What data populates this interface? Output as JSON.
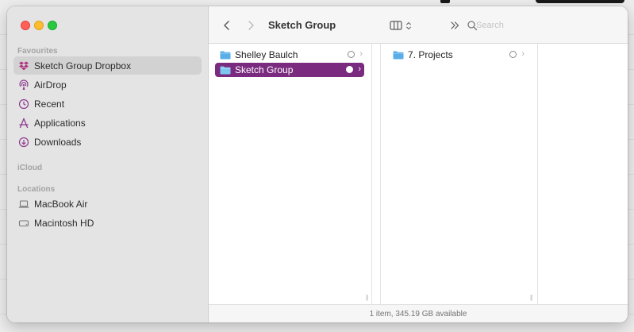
{
  "window": {
    "title": "Sketch Group"
  },
  "sidebar": {
    "sections": {
      "favourites": "Favourites",
      "icloud": "iCloud",
      "locations": "Locations"
    },
    "favourites": [
      {
        "label": "Sketch Group Dropbox",
        "icon": "dropbox-icon",
        "selected": true
      },
      {
        "label": "AirDrop",
        "icon": "airdrop-icon"
      },
      {
        "label": "Recent",
        "icon": "clock-icon"
      },
      {
        "label": "Applications",
        "icon": "applications-icon"
      },
      {
        "label": "Downloads",
        "icon": "download-icon"
      }
    ],
    "locations": [
      {
        "label": "MacBook Air",
        "icon": "laptop-icon"
      },
      {
        "label": "Macintosh HD",
        "icon": "disk-icon"
      }
    ]
  },
  "toolbar": {
    "title": "Sketch Group",
    "search_placeholder": "Search"
  },
  "columns": [
    {
      "items": [
        {
          "label": "Shelley Baulch",
          "icon": "folder-icon",
          "selected": false
        },
        {
          "label": "Sketch Group",
          "icon": "folder-icon",
          "selected": true
        }
      ]
    },
    {
      "items": [
        {
          "label": "7. Projects",
          "icon": "folder-icon",
          "selected": false
        }
      ]
    }
  ],
  "status": {
    "text": "1 item, 345.19 GB available"
  },
  "colors": {
    "selection": "#7a2b7f",
    "dropbox": "#b0337f",
    "folder": "#5aaee8",
    "sidebar_icon": "#8e3b8e"
  }
}
